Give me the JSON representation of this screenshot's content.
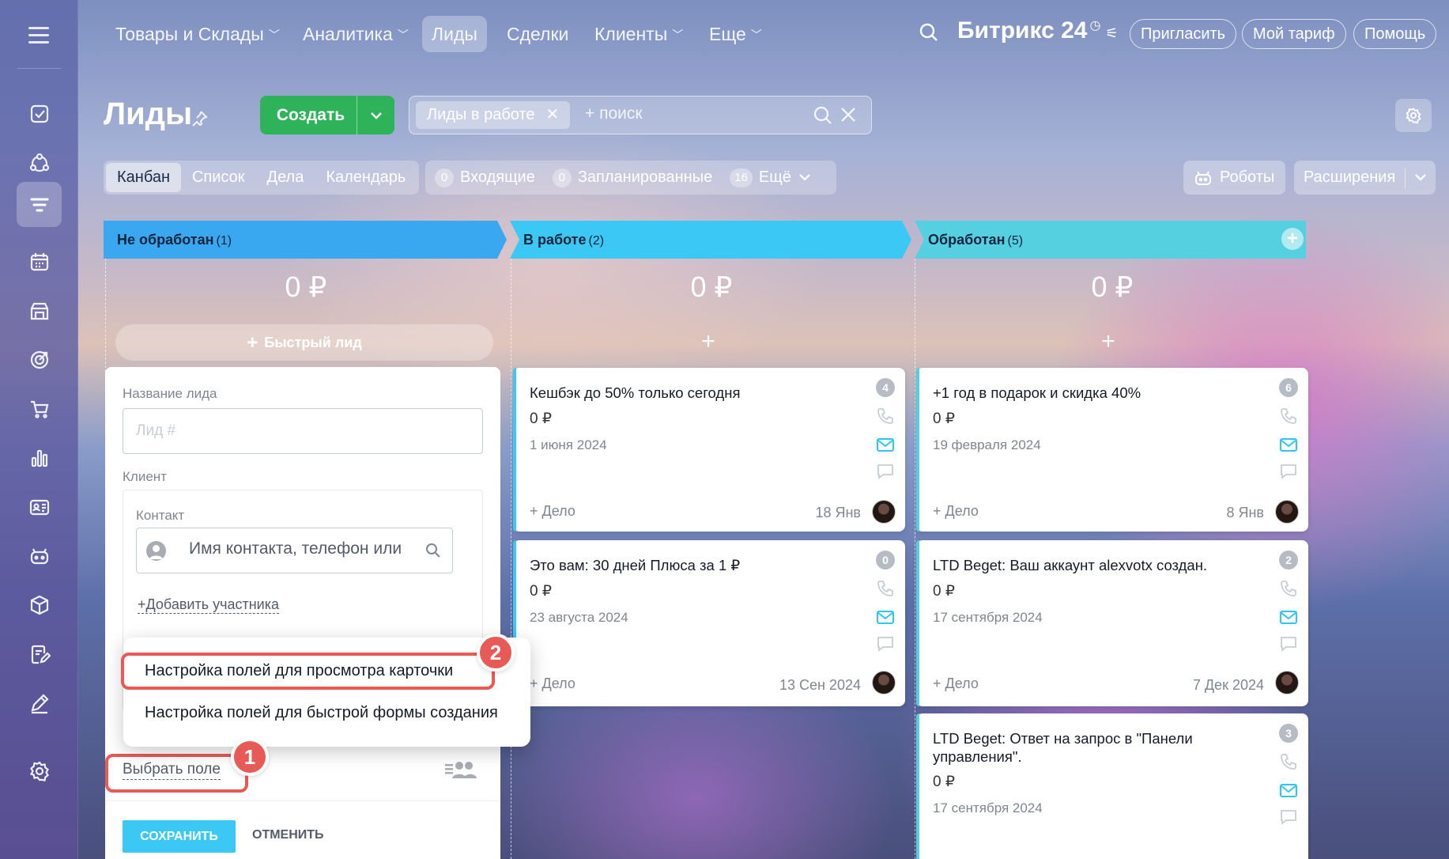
{
  "sidebar": {
    "items": [
      {
        "icon": "tasks-icon"
      },
      {
        "icon": "feed-icon"
      },
      {
        "icon": "crm-icon",
        "active": true
      },
      {
        "icon": "calendar-icon"
      },
      {
        "icon": "store-icon"
      },
      {
        "icon": "goals-icon"
      },
      {
        "icon": "cart-icon"
      },
      {
        "icon": "analytics-icon"
      },
      {
        "icon": "contacts-card-icon"
      },
      {
        "icon": "robot-icon"
      },
      {
        "icon": "box-icon"
      },
      {
        "icon": "document-edit-icon"
      },
      {
        "icon": "sign-icon"
      },
      {
        "icon": "settings-icon"
      }
    ]
  },
  "topnav": {
    "items": [
      {
        "label": "Товары и Склады",
        "dropdown": true
      },
      {
        "label": "Аналитика",
        "dropdown": true
      },
      {
        "label": "Лиды",
        "active": true
      },
      {
        "label": "Сделки"
      },
      {
        "label": "Клиенты",
        "dropdown": true
      },
      {
        "label": "Еще",
        "dropdown": true
      }
    ],
    "logo": "Битрикс 24",
    "invite": "Пригласить",
    "tariff": "Мой тариф",
    "help": "Помощь"
  },
  "header": {
    "title": "Лиды",
    "create": "Создать",
    "filter_tag": "Лиды в работе",
    "search_placeholder": "+ поиск"
  },
  "views": {
    "tabs": [
      "Канбан",
      "Список",
      "Дела",
      "Календарь"
    ],
    "active": "Канбан"
  },
  "counters": [
    {
      "count": "0",
      "label": "Входящие"
    },
    {
      "count": "0",
      "label": "Запланированные"
    },
    {
      "count": "16",
      "label": "Ещё"
    }
  ],
  "robots": "Роботы",
  "extensions": "Расширения",
  "columns": [
    {
      "title": "Не обработан",
      "count": "(1)",
      "sum": "0 ₽",
      "color": "#3aa8f0"
    },
    {
      "title": "В работе",
      "count": "(2)",
      "sum": "0 ₽",
      "color": "#3bc8f5"
    },
    {
      "title": "Обработан",
      "count": "(5)",
      "sum": "0 ₽",
      "color": "#55d0e0"
    }
  ],
  "quick_lead": "Быстрый лид",
  "quick_form": {
    "lead_name_label": "Название лида",
    "lead_name_placeholder": "Лид #",
    "client_label": "Клиент",
    "contact_label": "Контакт",
    "contact_placeholder": "Имя контакта, телефон или",
    "add_participant": "Добавить участника",
    "choose_field": "Выбрать поле",
    "save": "СОХРАНИТЬ",
    "cancel": "ОТМЕНИТЬ"
  },
  "popup_menu": {
    "item1": "Настройка полей для просмотра карточки",
    "item2": "Настройка полей для быстрой формы создания"
  },
  "steps": {
    "one": "1",
    "two": "2"
  },
  "cards": {
    "c1": {
      "title": "Кешбэк до 50% только сегодня",
      "price": "0 ₽",
      "date": "1 июня 2024",
      "deal": "+ Дело",
      "deal_date": "18 Янв",
      "badge": "4"
    },
    "c2": {
      "title": "Это вам: 30 дней Плюса за 1 ₽",
      "price": "0 ₽",
      "date": "23 августа 2024",
      "deal": "+ Дело",
      "deal_date": "13 Сен 2024",
      "badge": "0"
    },
    "c3": {
      "title": "+1 год в подарок и скидка 40%",
      "price": "0 ₽",
      "date": "19 февраля 2024",
      "deal": "+ Дело",
      "deal_date": "8 Янв",
      "badge": "6"
    },
    "c4": {
      "title": "LTD Beget: Ваш аккаунт alexvotx создан.",
      "price": "0 ₽",
      "date": "17 сентября 2024",
      "deal": "+ Дело",
      "deal_date": "7 Дек 2024",
      "badge": "2"
    },
    "c5": {
      "title": "LTD Beget: Ответ на запрос в \"Панели управления\".",
      "price": "0 ₽",
      "date": "17 сентября 2024",
      "badge": "3"
    }
  }
}
